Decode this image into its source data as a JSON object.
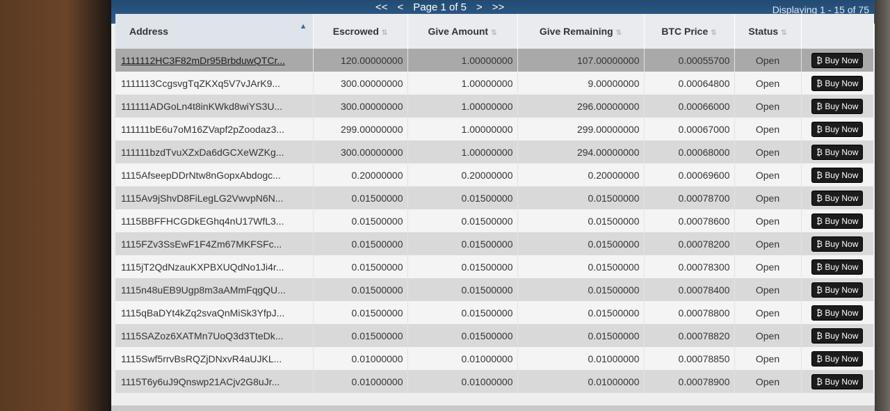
{
  "pager": {
    "first": "<<",
    "prev": "<",
    "page_label": "Page 1 of 5",
    "next": ">",
    "last": ">>",
    "displaying": "Displaying 1 - 15 of 75"
  },
  "table": {
    "columns": [
      "Address",
      "Escrowed",
      "Give Amount",
      "Give Remaining",
      "BTC Price",
      "Status",
      ""
    ],
    "button_label": "₿ Buy Now",
    "rows": [
      {
        "address": "1111112HC3F82mDr95BrbduwQTCr...",
        "escrowed": "120.00000000",
        "give_amount": "1.00000000",
        "give_remaining": "107.00000000",
        "btc_price": "0.00055700",
        "status": "Open"
      },
      {
        "address": "1111113CcgsvgTqZKXq5V7vJArK9...",
        "escrowed": "300.00000000",
        "give_amount": "1.00000000",
        "give_remaining": "9.00000000",
        "btc_price": "0.00064800",
        "status": "Open"
      },
      {
        "address": "111111ADGoLn4t8inKWkd8wiYS3U...",
        "escrowed": "300.00000000",
        "give_amount": "1.00000000",
        "give_remaining": "296.00000000",
        "btc_price": "0.00066000",
        "status": "Open"
      },
      {
        "address": "111111bE6u7oM16ZVapf2pZoodaz3...",
        "escrowed": "299.00000000",
        "give_amount": "1.00000000",
        "give_remaining": "299.00000000",
        "btc_price": "0.00067000",
        "status": "Open"
      },
      {
        "address": "111111bzdTvuXZxDa6dGCXeWZKg...",
        "escrowed": "300.00000000",
        "give_amount": "1.00000000",
        "give_remaining": "294.00000000",
        "btc_price": "0.00068000",
        "status": "Open"
      },
      {
        "address": "1115AfseepDDrNtw8nGopxAbdogc...",
        "escrowed": "0.20000000",
        "give_amount": "0.20000000",
        "give_remaining": "0.20000000",
        "btc_price": "0.00069600",
        "status": "Open"
      },
      {
        "address": "1115Av9jShvD8FiLegLG2VwvpN6N...",
        "escrowed": "0.01500000",
        "give_amount": "0.01500000",
        "give_remaining": "0.01500000",
        "btc_price": "0.00078700",
        "status": "Open"
      },
      {
        "address": "1115BBFFHCGDkEGhq4nU17WfL3...",
        "escrowed": "0.01500000",
        "give_amount": "0.01500000",
        "give_remaining": "0.01500000",
        "btc_price": "0.00078600",
        "status": "Open"
      },
      {
        "address": "1115FZv3SsEwF1F4Zm67MKFSFc...",
        "escrowed": "0.01500000",
        "give_amount": "0.01500000",
        "give_remaining": "0.01500000",
        "btc_price": "0.00078200",
        "status": "Open"
      },
      {
        "address": "1115jT2QdNzauKXPBXUQdNo1Ji4r...",
        "escrowed": "0.01500000",
        "give_amount": "0.01500000",
        "give_remaining": "0.01500000",
        "btc_price": "0.00078300",
        "status": "Open"
      },
      {
        "address": "1115n48uEB9Ugp8m3aAMmFqgQU...",
        "escrowed": "0.01500000",
        "give_amount": "0.01500000",
        "give_remaining": "0.01500000",
        "btc_price": "0.00078400",
        "status": "Open"
      },
      {
        "address": "1115qBaDYt4kZq2svaQnMiSk3YfpJ...",
        "escrowed": "0.01500000",
        "give_amount": "0.01500000",
        "give_remaining": "0.01500000",
        "btc_price": "0.00078800",
        "status": "Open"
      },
      {
        "address": "1115SAZoz6XATMn7UoQ3d3TteDk...",
        "escrowed": "0.01500000",
        "give_amount": "0.01500000",
        "give_remaining": "0.01500000",
        "btc_price": "0.00078820",
        "status": "Open"
      },
      {
        "address": "1115Swf5rrvBsRQZjDNxvR4aUJKL...",
        "escrowed": "0.01000000",
        "give_amount": "0.01000000",
        "give_remaining": "0.01000000",
        "btc_price": "0.00078850",
        "status": "Open"
      },
      {
        "address": "1115T6y6uJ9Qnswp21ACjv2G8uJr...",
        "escrowed": "0.01000000",
        "give_amount": "0.01000000",
        "give_remaining": "0.01000000",
        "btc_price": "0.00078900",
        "status": "Open"
      }
    ]
  },
  "colors": {
    "pager_bg": "#2f5f8c",
    "row_highlight": "#a9a9a9",
    "button_bg": "#1c1c1c"
  }
}
